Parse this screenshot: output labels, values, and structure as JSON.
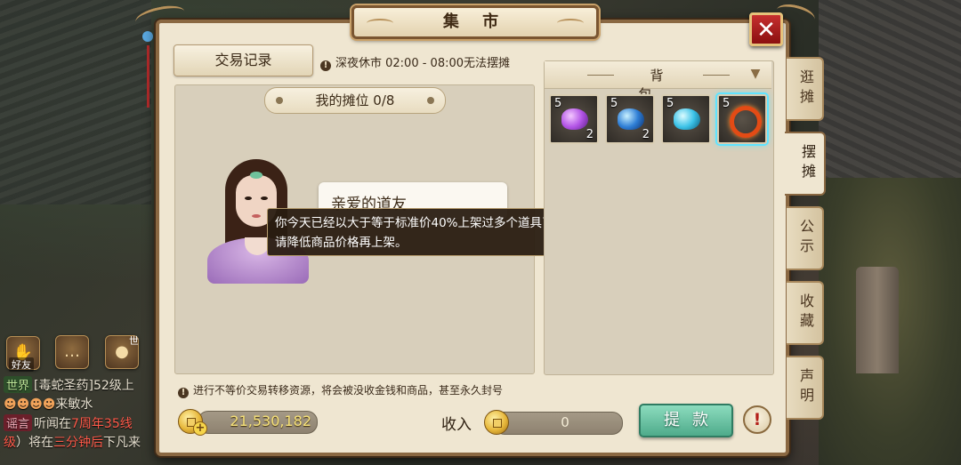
{
  "window": {
    "title": "集 市",
    "close_symbol": "✕"
  },
  "toolbar": {
    "trade_record_label": "交易记录",
    "night_notice": "深夜休市 02:00 - 08:00无法摆摊"
  },
  "stall": {
    "header": "我的摊位 0/8",
    "npc_greeting": "亲爱的道友",
    "tooltip": "你今天已经以大于等于标准价40%上架过多个道具了，存在不等价交易风险，请降低商品价格再上架。",
    "warning": "进行不等价交易转移资源，将会被没收金钱和商品，甚至永久封号"
  },
  "bag": {
    "title": "背包",
    "items": [
      {
        "icon": "purple-gem-icon",
        "level": "5",
        "count": "2"
      },
      {
        "icon": "blue-crystal-icon",
        "level": "5",
        "count": "2"
      },
      {
        "icon": "cyan-gem-icon",
        "level": "5",
        "count": ""
      },
      {
        "icon": "fire-ring-icon",
        "level": "5",
        "count": "",
        "selected": true
      }
    ]
  },
  "side_tabs": [
    {
      "label": "逛摊",
      "active": false
    },
    {
      "label": "摆摊",
      "active": true
    },
    {
      "label": "公示",
      "active": false
    },
    {
      "label": "收藏",
      "active": false
    },
    {
      "label": "声明",
      "active": false
    }
  ],
  "footer": {
    "gold_amount": "21,530,182",
    "income_label": "收入",
    "income_amount": "0",
    "withdraw_label": "提款",
    "help_symbol": "!"
  },
  "social": {
    "friends_label": "好友",
    "voice_badge": "世"
  },
  "chat": {
    "world_tag": "世界",
    "world_line": "[毒蛇圣药]52级上",
    "emote_line": "来敏水",
    "rumor_tag": "谣言",
    "rumor_pre": "听闻在",
    "rumor_red": "7周年35线",
    "line3_red_start": "级",
    "line3_mid": "）将在",
    "line3_red": "三分钟后",
    "line3_end": "下凡来"
  },
  "colors": {
    "panel_bg": "#efe6d1",
    "frame": "#8a6842",
    "withdraw_green": "#4fab8b",
    "close_red": "#c62f2f",
    "gold_text": "#f7e27a"
  }
}
